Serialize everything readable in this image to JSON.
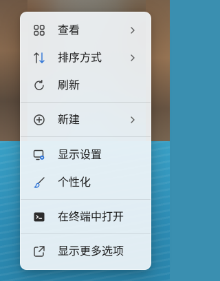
{
  "menu": {
    "items": [
      {
        "label": "查看",
        "icon": "grid-view-icon",
        "has_submenu": true
      },
      {
        "label": "排序方式",
        "icon": "sort-arrows-icon",
        "has_submenu": true
      },
      {
        "label": "刷新",
        "icon": "refresh-icon",
        "has_submenu": false
      },
      {
        "label": "新建",
        "icon": "plus-circle-icon",
        "has_submenu": true
      },
      {
        "label": "显示设置",
        "icon": "display-settings-icon",
        "has_submenu": false
      },
      {
        "label": "个性化",
        "icon": "brush-icon",
        "has_submenu": false
      },
      {
        "label": "在终端中打开",
        "icon": "terminal-icon",
        "has_submenu": false
      },
      {
        "label": "显示更多选项",
        "icon": "open-external-icon",
        "has_submenu": false
      }
    ]
  },
  "colors": {
    "menu_background": "#f1f5f9",
    "text": "#1b1b1b",
    "accent": "#2b72d6",
    "icon_gray": "#3a3a3a"
  }
}
